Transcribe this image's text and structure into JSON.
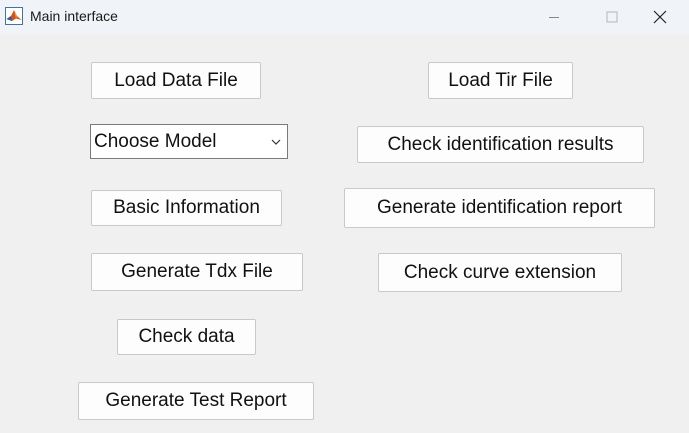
{
  "window": {
    "title": "Main interface",
    "app_icon": "matlab-logo-icon",
    "controls": {
      "minimize": "minimize-icon",
      "maximize": "maximize-icon",
      "close": "close-icon"
    }
  },
  "left_column": {
    "load_data_file": "Load Data File",
    "model_select": {
      "selected": "Choose Model"
    },
    "basic_information": "Basic Information",
    "generate_tdx_file": "Generate Tdx File",
    "check_data": "Check data",
    "generate_test_report": "Generate Test Report"
  },
  "right_column": {
    "load_tir_file": "Load Tir File",
    "check_identification_results": "Check identification results",
    "generate_identification_report": "Generate identification report",
    "check_curve_extension": "Check curve extension"
  }
}
